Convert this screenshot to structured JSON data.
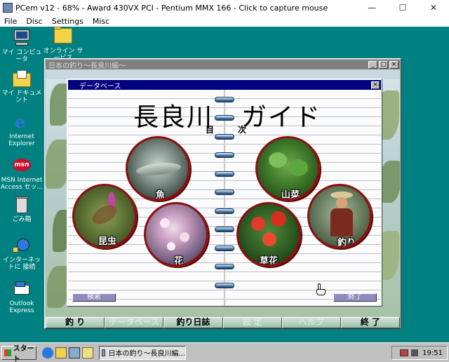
{
  "host": {
    "title": "PCem v12 - 68% - Award 430VX PCI - Pentium MMX 166 - Click to capture mouse",
    "menu": [
      "File",
      "Disc",
      "Settings",
      "Misc"
    ],
    "minimize_glyph": "—",
    "maximize_glyph": "☐",
    "close_glyph": "✕"
  },
  "desktop": {
    "icons": [
      {
        "label": "マイ コンピュータ"
      },
      {
        "label": "オンライン サービス"
      },
      {
        "label": "マイ ドキュメント"
      },
      {
        "label": "Internet Explorer"
      },
      {
        "label": "MSN Internet Access セッ..."
      },
      {
        "label": "ごみ箱"
      },
      {
        "label": "インターネットに 接続"
      },
      {
        "label": "Outlook Express"
      }
    ]
  },
  "game_window": {
    "title": "日本の釣り〜長良川編〜",
    "min_glyph": "_",
    "max_glyph": "□",
    "close_glyph": "×"
  },
  "db_dialog": {
    "title": "データベース",
    "close_glyph": "×",
    "heading_left": "長良川",
    "heading_right": "ガイド",
    "toc_left": "目",
    "toc_right": "次",
    "categories": {
      "fish": "魚",
      "insects": "昆虫",
      "flowers": "花",
      "wild_vegetables": "山菜",
      "grasses": "草花",
      "fishing": "釣り"
    },
    "search_button": "検索",
    "exit_button": "終了"
  },
  "nav": {
    "items": [
      {
        "label": "釣 り",
        "dim": false
      },
      {
        "label": "データベース",
        "dim": true
      },
      {
        "label": "釣り日誌",
        "dim": false
      },
      {
        "label": "設 定",
        "dim": true
      },
      {
        "label": "ヘルプ",
        "dim": true
      },
      {
        "label": "終 了",
        "dim": false
      }
    ]
  },
  "taskbar": {
    "start_label": "スタート",
    "task_label": "日本の釣り〜長良川編...",
    "clock": "19:51"
  }
}
